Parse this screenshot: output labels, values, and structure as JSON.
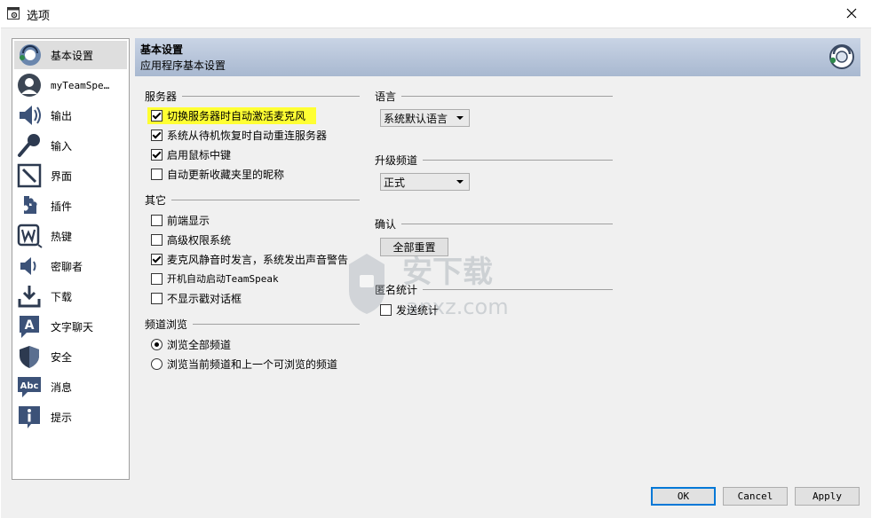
{
  "window": {
    "title": "选项"
  },
  "sidebar": {
    "items": [
      {
        "label": "基本设置",
        "icon": "teamspeak-logo-icon",
        "active": true
      },
      {
        "label": "myTeamSpe…",
        "icon": "user-avatar-icon"
      },
      {
        "label": "输出",
        "icon": "speaker-icon"
      },
      {
        "label": "输入",
        "icon": "microphone-icon"
      },
      {
        "label": "界面",
        "icon": "pencil-icon"
      },
      {
        "label": "插件",
        "icon": "puzzle-icon"
      },
      {
        "label": "热键",
        "icon": "keyboard-w-icon"
      },
      {
        "label": "密聊者",
        "icon": "whisper-speaker-icon"
      },
      {
        "label": "下载",
        "icon": "download-icon"
      },
      {
        "label": "文字聊天",
        "icon": "chat-a-icon"
      },
      {
        "label": "安全",
        "icon": "shield-icon"
      },
      {
        "label": "消息",
        "icon": "abc-bubble-icon"
      },
      {
        "label": "提示",
        "icon": "info-icon"
      }
    ]
  },
  "header": {
    "title": "基本设置",
    "subtitle": "应用程序基本设置"
  },
  "server": {
    "label": "服务器",
    "options": [
      {
        "label": "切换服务器时自动激活麦克风",
        "checked": true,
        "highlighted": true
      },
      {
        "label": "系统从待机恢复时自动重连服务器",
        "checked": true
      },
      {
        "label": "启用鼠标中键",
        "checked": true
      },
      {
        "label": "自动更新收藏夹里的昵称",
        "checked": false
      }
    ]
  },
  "other": {
    "label": "其它",
    "options": [
      {
        "label": "前端显示",
        "checked": false
      },
      {
        "label": "高级权限系统",
        "checked": false
      },
      {
        "label": "麦克风静音时发言，系统发出声音警告",
        "checked": true
      },
      {
        "label": "开机自动启动TeamSpeak",
        "checked": false
      },
      {
        "label": "不显示戳对话框",
        "checked": false
      }
    ]
  },
  "channel_browse": {
    "label": "频道浏览",
    "options": [
      {
        "label": "浏览全部频道",
        "selected": true
      },
      {
        "label": "浏览当前频道和上一个可浏览的频道",
        "selected": false
      }
    ]
  },
  "language": {
    "label": "语言",
    "value": "系统默认语言"
  },
  "upgrade_channel": {
    "label": "升级频道",
    "value": "正式"
  },
  "confirm": {
    "label": "确认",
    "reset_label": "全部重置"
  },
  "anonymous_stats": {
    "label": "匿名统计",
    "send_label": "发送统计",
    "checked": false
  },
  "footer": {
    "ok": "OK",
    "cancel": "Cancel",
    "apply": "Apply"
  },
  "watermark": {
    "text": "安下载",
    "domain": "anxz.com"
  },
  "colors": {
    "highlight": "#ffff33",
    "header_gradient_top": "#c9d4e5",
    "header_gradient_bottom": "#a8b8d0",
    "default_button_border": "#0078d7"
  }
}
